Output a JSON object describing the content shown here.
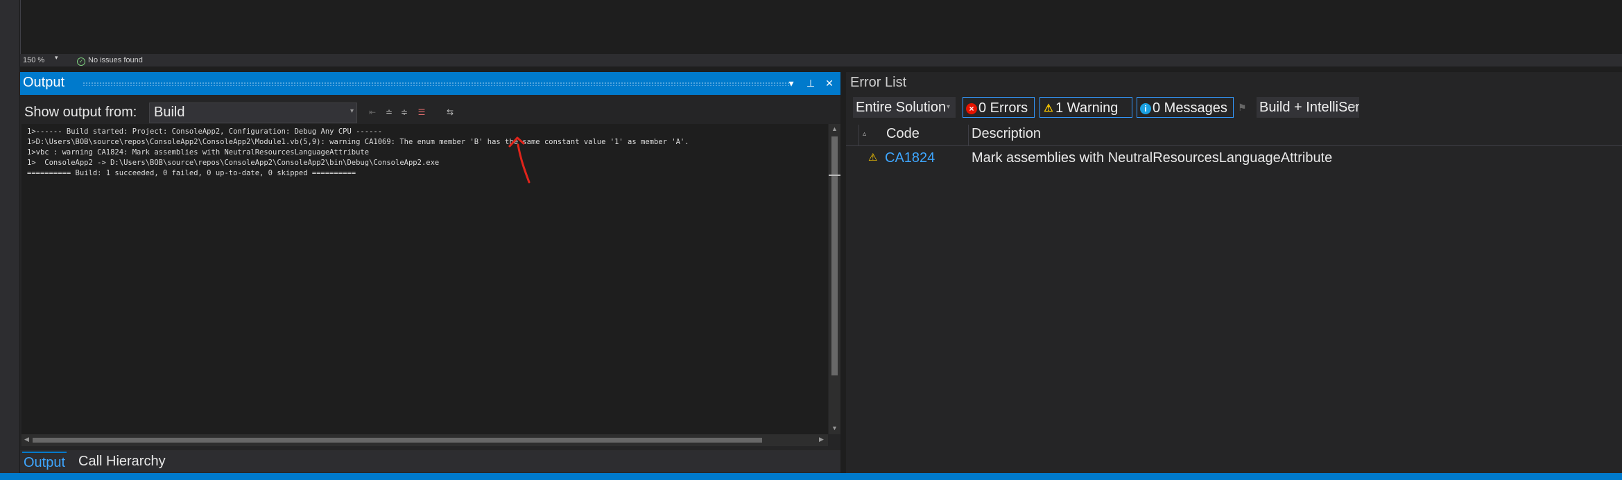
{
  "editor_status": {
    "zoom": "150 %",
    "issues": "No issues found"
  },
  "output": {
    "title": "Output",
    "show_label": "Show output from:",
    "source": "Build",
    "lines": [
      "1>------ Build started: Project: ConsoleApp2, Configuration: Debug Any CPU ------",
      "1>D:\\Users\\BOB\\source\\repos\\ConsoleApp2\\ConsoleApp2\\Module1.vb(5,9): warning CA1069: The enum member 'B' has the same constant value '1' as member 'A'.",
      "1>vbc : warning CA1824: Mark assemblies with NeutralResourcesLanguageAttribute",
      "1>  ConsoleApp2 -> D:\\Users\\BOB\\source\\repos\\ConsoleApp2\\ConsoleApp2\\bin\\Debug\\ConsoleApp2.exe",
      "========== Build: 1 succeeded, 0 failed, 0 up-to-date, 0 skipped =========="
    ],
    "tabs": [
      "Output",
      "Call Hierarchy"
    ]
  },
  "error_list": {
    "title": "Error List",
    "scope": "Entire Solution",
    "errors": "0 Errors",
    "warnings": "1 Warning",
    "messages": "0 Messages",
    "build_filter": "Build + IntelliSense",
    "columns": [
      "Code",
      "Description"
    ],
    "rows": [
      {
        "code": "CA1824",
        "description": "Mark assemblies with NeutralResourcesLanguageAttribute"
      }
    ]
  },
  "colors": {
    "accent": "#007acc",
    "link": "#3ea6ff",
    "annotation_arrow": "#e0241b"
  }
}
